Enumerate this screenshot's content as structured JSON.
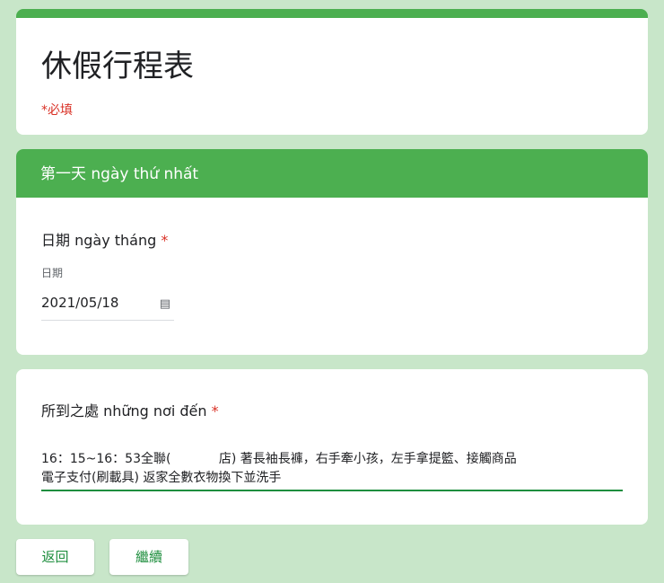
{
  "form": {
    "title": "休假行程表",
    "required_note": "*必填"
  },
  "section": {
    "title": "第一天 ngày thứ nhất"
  },
  "date_question": {
    "label": "日期 ngày tháng",
    "required_mark": "*",
    "sub_label": "日期",
    "value": "2021/05/18",
    "icon": "calendar-icon"
  },
  "places_question": {
    "label": "所到之處 những nơi đến",
    "required_mark": "*",
    "value": "16：15~16：53全聯(            店) 著長袖長褲，右手牽小孩，左手拿提籃、接觸商品\n電子支付(刷載具) 返家全數衣物換下並洗手"
  },
  "buttons": {
    "back": "返回",
    "next": "繼續"
  }
}
